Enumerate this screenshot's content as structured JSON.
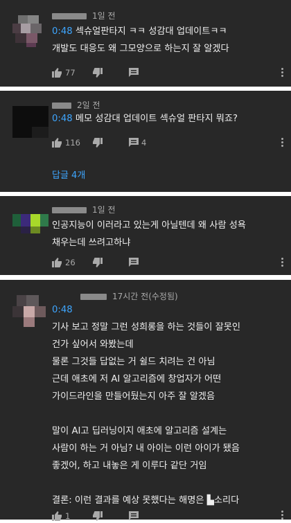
{
  "comments": [
    {
      "time": "1일 전",
      "timestamp": "0:48",
      "lines": [
        "섹슈얼판타지 ㅋㅋ 성감대 업데이트ㅋㅋ",
        "개발도 대응도 왜 그모양으로 하는지 잘 알겠다"
      ],
      "likes": "77",
      "reply_count": ""
    },
    {
      "time": "2일 전",
      "timestamp": "0:48",
      "lines": [
        "메모 성감대 업데이트 섹슈얼 판타지 뭐죠?"
      ],
      "likes": "116",
      "reply_count": "4",
      "replies_link": "답글 4개"
    },
    {
      "time": "1일 전",
      "timestamp": "",
      "lines": [
        "인공지능이 이러라고 있는게 아닐텐데 왜 사람 성욕",
        "채우는데 쓰려고하냐"
      ],
      "likes": "26",
      "reply_count": ""
    },
    {
      "time": "17시간 전(수정됨)",
      "timestamp": "0:48",
      "lines": [
        "기사 보고 정말 그런 성희롱을 하는 것들이 잘못인",
        "건가 싶어서 와봤는데",
        "물론 그것들 답없는 거 쉴드 치려는 건 아님",
        "근데 애초에 저 AI 알고리즘에 창업자가 어떤",
        "가이드라인을 만들어뒀는지 아주 잘 알겠음",
        "",
        "말이 AI고 딥러닝이지 애초에 알고리즘 설계는",
        "사람이 하는 거 아님? 내 아이는 이런 아이가 됐음",
        "좋겠어, 하고 내놓은 게 이루다 같단 거임",
        "",
        "결론: 이런 결과를 예상 못했다는 해명은 ▙소리다"
      ],
      "likes": "1",
      "reply_count": ""
    }
  ],
  "icons": {
    "like": "thumbs-up-icon",
    "dislike": "thumbs-down-icon",
    "reply": "comment-icon",
    "more": "more-vertical-icon"
  },
  "colors": {
    "background": "#282828",
    "separator": "#ffffff",
    "timestamp_link": "#3ea6ff",
    "secondary_text": "#aaaaaa"
  }
}
